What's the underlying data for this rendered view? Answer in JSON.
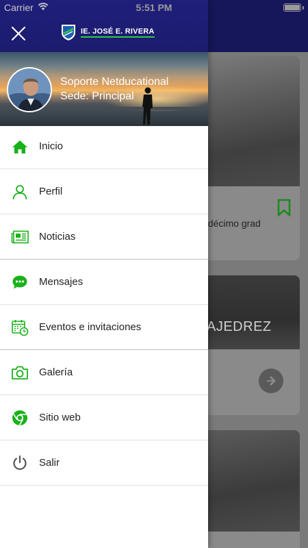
{
  "status_bar": {
    "carrier": "Carrier",
    "time": "5:51 PM"
  },
  "header": {
    "logo_text": "IE. JOSÉ E. RIVERA"
  },
  "profile": {
    "name": "Soporte Netducational",
    "sede": "Sede: Principal"
  },
  "menu": {
    "items": [
      {
        "label": "Inicio",
        "icon": "home-icon"
      },
      {
        "label": "Perfil",
        "icon": "user-icon"
      },
      {
        "label": "Noticias",
        "icon": "newspaper-icon"
      },
      {
        "label": "Mensajes",
        "icon": "chat-icon"
      },
      {
        "label": "Eventos e invitaciones",
        "icon": "calendar-clock-icon"
      },
      {
        "label": "Galería",
        "icon": "camera-icon"
      },
      {
        "label": "Sitio web",
        "icon": "browser-icon"
      },
      {
        "label": "Salir",
        "icon": "power-icon"
      }
    ]
  },
  "background": {
    "card1_text": "ndécimo grad",
    "card2_text": "AJEDREZ"
  },
  "colors": {
    "accent": "#19b219",
    "header": "#1b1b6e"
  }
}
